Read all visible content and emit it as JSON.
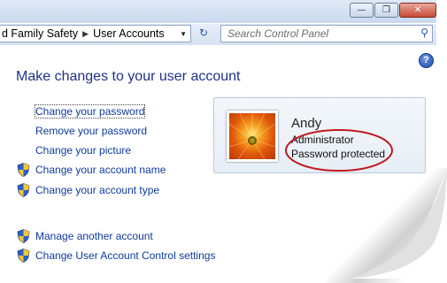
{
  "window": {
    "minimize_glyph": "—",
    "maximize_glyph": "❐",
    "close_glyph": "✕"
  },
  "address": {
    "crumbs": [
      "d Family Safety",
      "User Accounts"
    ],
    "refresh_glyph": "↻",
    "search_placeholder": "Search Control Panel"
  },
  "main": {
    "title": "Make changes to your user account",
    "links": [
      {
        "label": "Change your password",
        "shield": false
      },
      {
        "label": "Remove your password",
        "shield": false
      },
      {
        "label": "Change your picture",
        "shield": false
      },
      {
        "label": "Change your account name",
        "shield": true
      },
      {
        "label": "Change your account type",
        "shield": true
      }
    ],
    "other_links": [
      {
        "label": "Manage another account",
        "shield": true
      },
      {
        "label": "Change User Account Control settings",
        "shield": true
      }
    ]
  },
  "account": {
    "name": "Andy",
    "type": "Administrator",
    "password_status": "Password protected"
  },
  "colors": {
    "link": "#0e3a9e",
    "heading": "#1e3287",
    "highlight_ellipse": "#c0191f"
  }
}
